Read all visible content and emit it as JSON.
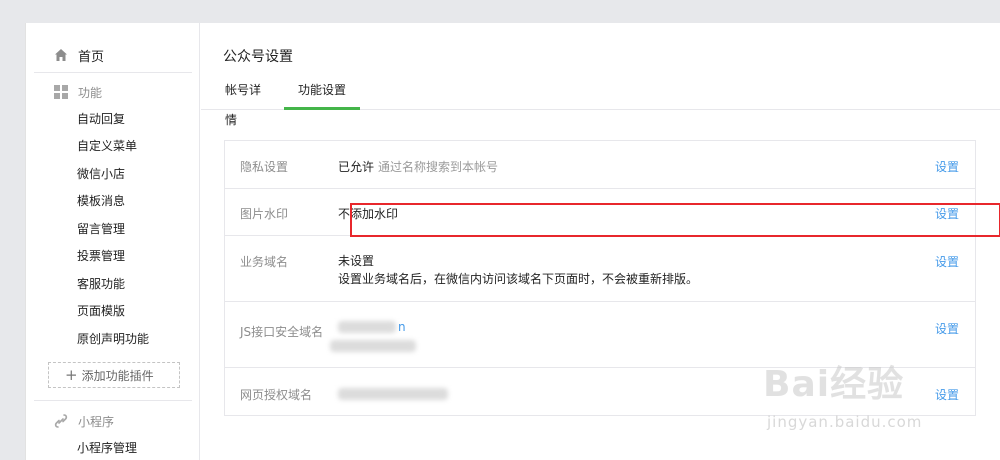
{
  "sidebar": {
    "home": {
      "label": "首页",
      "icon": "home-icon"
    },
    "features": {
      "label": "功能",
      "icon": "grid-icon",
      "items": [
        "自动回复",
        "自定义菜单",
        "微信小店",
        "模板消息",
        "留言管理",
        "投票管理",
        "客服功能",
        "页面模版",
        "原创声明功能"
      ]
    },
    "add_plugin": {
      "label": "添加功能插件",
      "icon": "plus-icon"
    },
    "mini_program": {
      "label": "小程序",
      "icon": "link-icon",
      "items": [
        "小程序管理"
      ]
    }
  },
  "main": {
    "title": "公众号设置",
    "tabs": [
      {
        "label": "帐号详情",
        "active": false
      },
      {
        "label": "功能设置",
        "active": true
      }
    ],
    "settings": [
      {
        "label": "隐私设置",
        "value": "已允许",
        "hint": "通过名称搜索到本帐号",
        "action": "设置"
      },
      {
        "label": "图片水印",
        "value": "不添加水印",
        "action": "设置",
        "highlighted": true
      },
      {
        "label": "业务域名",
        "value": "未设置",
        "detail": "设置业务域名后，在微信内访问该域名下页面时，不会被重新排版。",
        "action": "设置"
      },
      {
        "label": "JS接口安全域名",
        "value_blurred": "n",
        "action": "设置"
      },
      {
        "label": "网页授权域名",
        "action": "设置"
      }
    ]
  },
  "watermark": {
    "brand": "Bai经验",
    "url": "jingyan.baidu.com"
  },
  "colors": {
    "accent_green": "#44b549",
    "link_blue": "#459ae9",
    "highlight_red": "#e8272c"
  }
}
